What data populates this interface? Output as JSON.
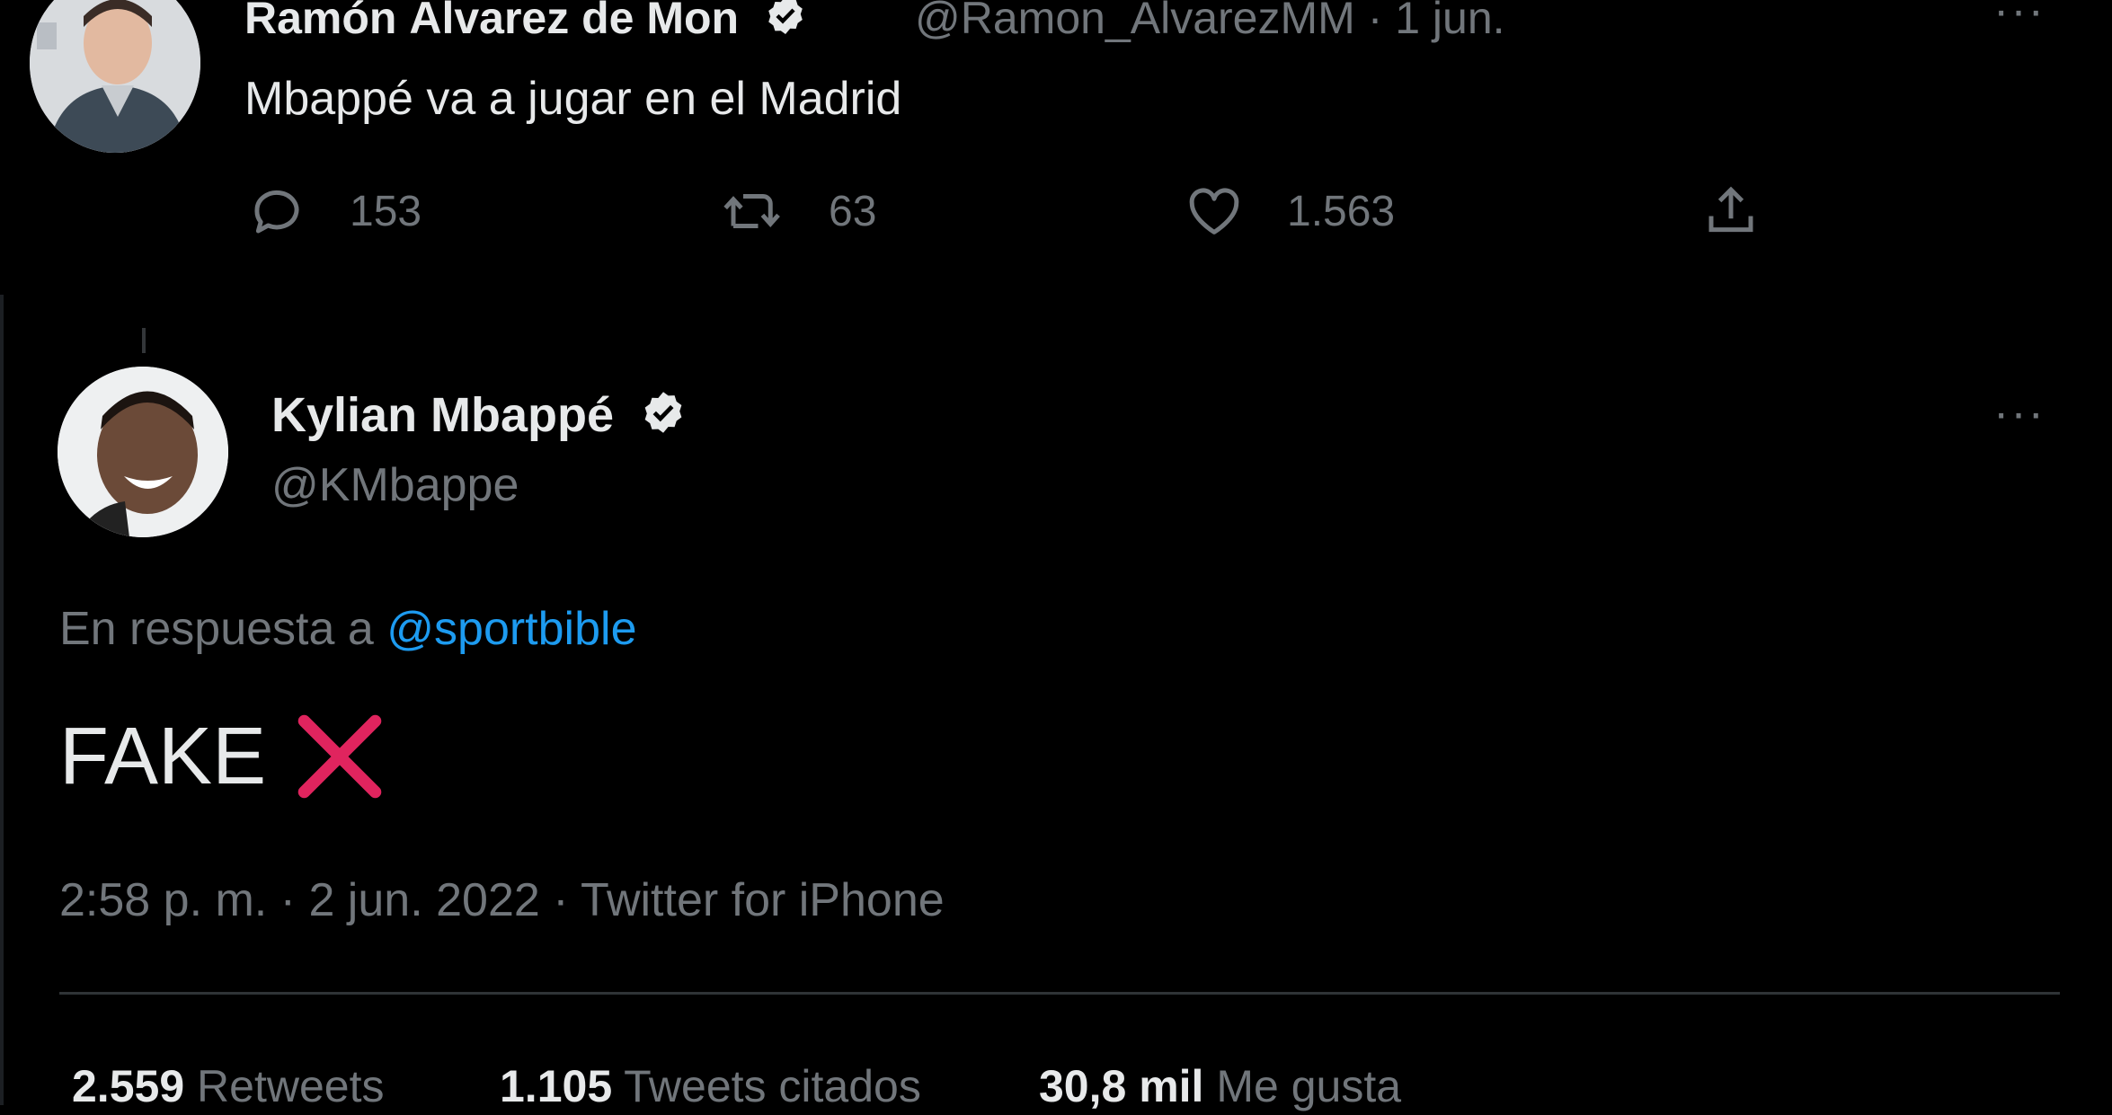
{
  "parent_tweet": {
    "author_name": "Ramón Álvarez de Mon",
    "handle": "@Ramon_AlvarezMM",
    "date": "1 jun.",
    "text": "Mbappé va a jugar en el Madrid",
    "more_label": "···",
    "replies": "153",
    "retweets": "63",
    "likes": "1.563"
  },
  "main_tweet": {
    "author_name": "Kylian Mbappé",
    "handle": "@KMbappe",
    "more_label": "···",
    "reply_to_prefix": "En respuesta a",
    "reply_to_mention": "@sportbible",
    "text": "FAKE",
    "timestamp": "2:58 p. m. · 2 jun. 2022 · Twitter for iPhone",
    "stats": {
      "retweets_count": "2.559",
      "retweets_label": "Retweets",
      "quotes_count": "1.105",
      "quotes_label": "Tweets citados",
      "likes_count": "30,8 mil",
      "likes_label": "Me gusta"
    }
  },
  "colors": {
    "background": "#000000",
    "text_primary": "#e7e9ea",
    "text_secondary": "#71767b",
    "accent": "#1d9bf0",
    "cross_mark": "#e0245e"
  },
  "icons": [
    "verified-badge-icon",
    "reply-icon",
    "retweet-icon",
    "like-icon",
    "share-icon",
    "more-icon",
    "cross-mark-icon"
  ]
}
